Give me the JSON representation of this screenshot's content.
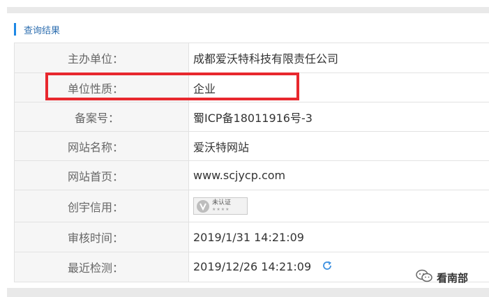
{
  "section": {
    "title": "查询结果"
  },
  "rows": [
    {
      "label": "主办单位：",
      "value": "成都爱沃特科技有限责任公司"
    },
    {
      "label": "单位性质：",
      "value": "企业"
    },
    {
      "label": "备案号：",
      "value": "蜀ICP备18011916号-3"
    },
    {
      "label": "网站名称：",
      "value": "爱沃特网站"
    },
    {
      "label": "网站首页：",
      "value": "www.scjycp.com"
    },
    {
      "label": "创宇信用：",
      "badge": {
        "status": "未认证",
        "stars": "★★★★"
      }
    },
    {
      "label": "审核时间：",
      "value": "2019/1/31 14:21:09"
    },
    {
      "label": "最近检测：",
      "value": "2019/12/26 14:21:09"
    }
  ],
  "icons": {
    "refresh": "refresh-icon",
    "wechat": "wechat-icon",
    "verify": "v-shield-icon"
  },
  "colors": {
    "accent": "#1e88e5",
    "highlight": "#e8282e"
  },
  "watermark": {
    "text": "看南部"
  }
}
